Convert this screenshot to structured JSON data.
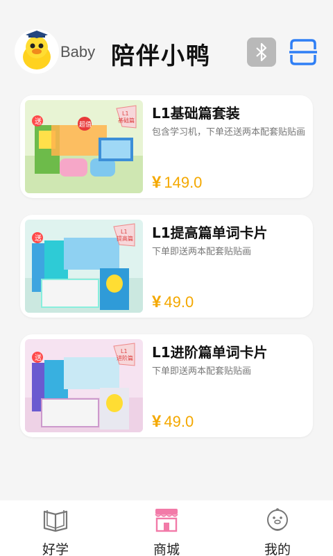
{
  "header": {
    "baby_label": "Baby",
    "app_title": "陪伴小鸭",
    "avatar_icon": "duck-avatar-icon",
    "bluetooth_icon": "bluetooth-icon",
    "scan_icon": "scan-icon"
  },
  "products": [
    {
      "title": "L1基础篇套装",
      "description": "包含学习机，下单还送两本配套贴贴画",
      "currency": "¥",
      "price": "149.0",
      "badge": "L1\n基础篇",
      "tag": "送",
      "promo": "超值"
    },
    {
      "title": "L1提高篇单词卡片",
      "description": "下单即送两本配套贴贴画",
      "currency": "¥",
      "price": "49.0",
      "badge": "L1\n提高篇",
      "tag": "送"
    },
    {
      "title": "L1进阶篇单词卡片",
      "description": "下单即送两本配套贴贴画",
      "currency": "¥",
      "price": "49.0",
      "badge": "L1\n进阶篇",
      "tag": "送"
    }
  ],
  "bottom_nav": [
    {
      "label": "好学",
      "icon": "book-icon"
    },
    {
      "label": "商城",
      "icon": "shop-icon",
      "active": true
    },
    {
      "label": "我的",
      "icon": "profile-icon"
    }
  ],
  "colors": {
    "price": "#f4a800",
    "accent_blue": "#2f7ff5",
    "shop_pink": "#f27aa8",
    "background": "#f5f5f5"
  }
}
